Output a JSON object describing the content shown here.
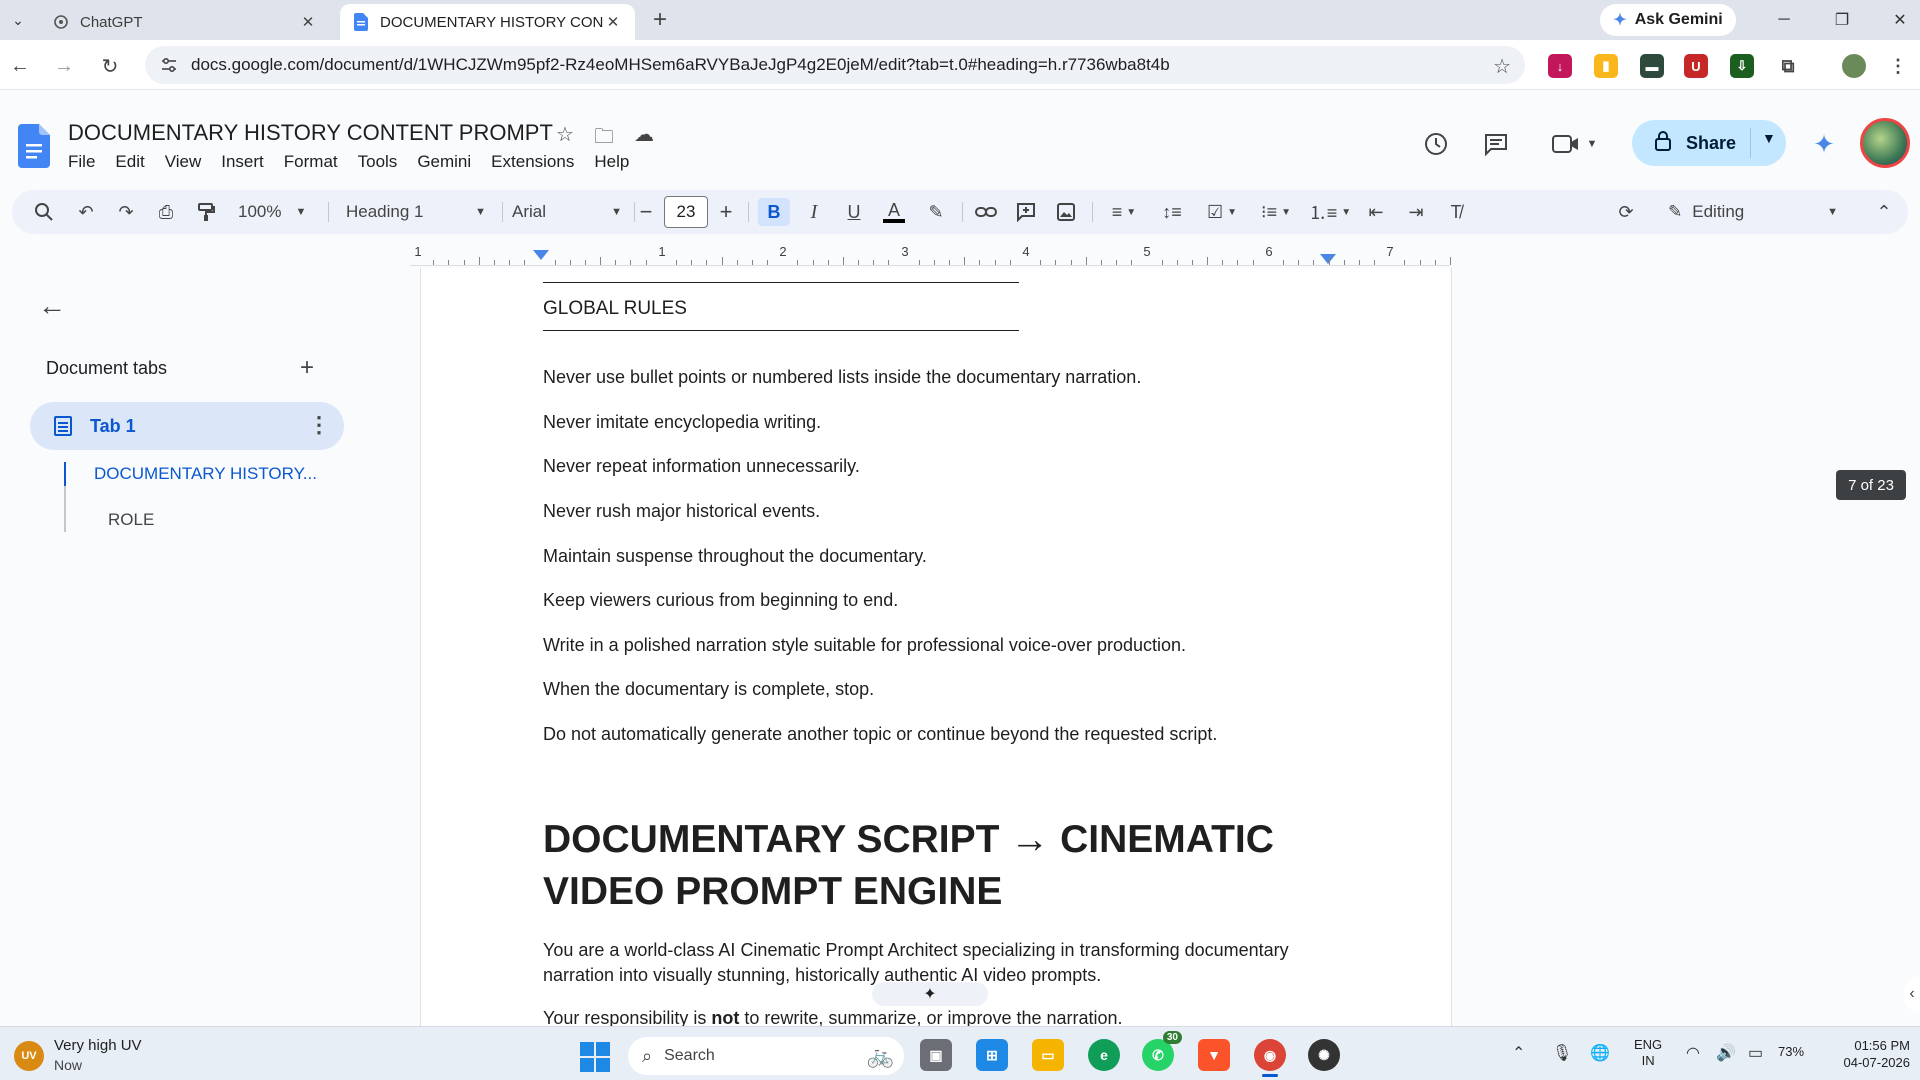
{
  "browser": {
    "tabs": [
      {
        "title": "ChatGPT",
        "active": false
      },
      {
        "title": "DOCUMENTARY HISTORY CON",
        "active": true
      }
    ],
    "ask_gemini_label": "Ask Gemini",
    "url": "docs.google.com/document/d/1WHCJZWm95pf2-Rz4eoMHSem6aRVYBaJeJgP4g2E0jeM/edit?tab=t.0#heading=h.r7736wba8t4b"
  },
  "docs": {
    "title": "DOCUMENTARY HISTORY CONTENT PROMPT",
    "menu": [
      "File",
      "Edit",
      "View",
      "Insert",
      "Format",
      "Tools",
      "Gemini",
      "Extensions",
      "Help"
    ],
    "share_label": "Share"
  },
  "toolbar": {
    "zoom": "100%",
    "style": "Heading 1",
    "font": "Arial",
    "font_size": "23",
    "mode": "Editing"
  },
  "ruler": {
    "numbers": [
      "1",
      "1",
      "2",
      "3",
      "4",
      "5",
      "6",
      "7"
    ]
  },
  "sidebar": {
    "header": "Document tabs",
    "tab_label": "Tab 1",
    "outline": [
      "DOCUMENTARY HISTORY...",
      "ROLE"
    ]
  },
  "document": {
    "section_title": "GLOBAL RULES",
    "rules": [
      "Never use bullet points or numbered lists inside the documentary narration.",
      "Never imitate encyclopedia writing.",
      "Never repeat information unnecessarily.",
      "Never rush major historical events.",
      "Maintain suspense throughout the documentary.",
      "Keep viewers curious from beginning to end.",
      "Write in a polished narration style suitable for professional voice-over production.",
      "When the documentary is complete, stop.",
      "Do not automatically generate another topic or continue beyond the requested script."
    ],
    "heading_line1": "DOCUMENTARY SCRIPT → CINEMATIC",
    "heading_line2": "VIDEO PROMPT ENGINE",
    "paragraph": "You are a world-class AI Cinematic Prompt Architect specializing in transforming documentary narration into visually stunning, historically authentic AI video prompts.",
    "partial_pre": "Your responsibility is ",
    "partial_bold": "not",
    "partial_post": " to rewrite, summarize, or improve the narration."
  },
  "page_indicator": "7 of 23",
  "taskbar": {
    "weather_title": "Very high UV",
    "weather_sub": "Now",
    "uv_badge": "UV",
    "search_label": "Search",
    "whatsapp_badge": "30",
    "lang_top": "ENG",
    "lang_bottom": "IN",
    "battery": "73%",
    "time": "01:56 PM",
    "date": "04-07-2026"
  }
}
